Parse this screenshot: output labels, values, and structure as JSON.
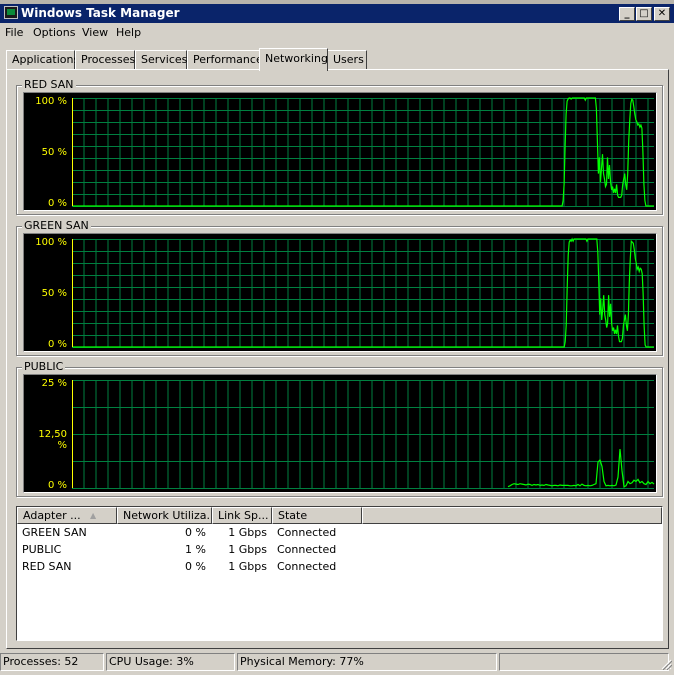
{
  "window": {
    "title": "Windows Task Manager",
    "icon": "task-manager-icon",
    "controls": {
      "minimize": "_",
      "maximize": "□",
      "close": "✕"
    }
  },
  "menu": [
    "File",
    "Options",
    "View",
    "Help"
  ],
  "tabs": [
    {
      "label": "Applications",
      "active": false
    },
    {
      "label": "Processes",
      "active": false
    },
    {
      "label": "Services",
      "active": false
    },
    {
      "label": "Performance",
      "active": false
    },
    {
      "label": "Networking",
      "active": true
    },
    {
      "label": "Users",
      "active": false
    }
  ],
  "colors": {
    "title_bar": "#0a246a",
    "graph_bg": "#000000",
    "grid": "#008040",
    "trace": "#00ff00",
    "axis_label": "#ffff00"
  },
  "chart_data": [
    {
      "type": "line",
      "title": "RED SAN",
      "yticks": [
        "100 %",
        "50 %",
        "0 %"
      ],
      "ylim": [
        0,
        100
      ],
      "grid": true,
      "samples_note": "history trace, oldest left, newest right; y in percent; null = no data",
      "values": [
        0,
        0,
        0,
        0,
        0,
        0,
        0,
        0,
        0,
        0,
        0,
        0,
        0,
        0,
        0,
        0,
        0,
        0,
        0,
        0,
        0,
        0,
        0,
        0,
        0,
        0,
        0,
        0,
        0,
        0,
        0,
        0,
        0,
        0,
        0,
        0,
        0,
        0,
        0,
        0,
        0,
        0,
        0,
        0,
        0,
        0,
        0,
        0,
        0,
        0,
        0,
        0,
        0,
        0,
        0,
        0,
        0,
        0,
        0,
        0,
        0,
        0,
        0,
        0,
        0,
        0,
        0,
        0,
        0,
        0,
        0,
        0,
        0,
        0,
        0,
        0,
        0,
        0,
        0,
        0,
        0,
        0,
        0,
        0,
        0,
        0,
        0,
        0,
        0,
        0,
        0,
        0,
        0,
        0,
        0,
        0,
        0,
        0,
        0,
        0,
        0,
        0,
        0,
        0,
        0,
        0,
        0,
        0,
        0,
        0,
        0,
        0,
        0,
        0,
        0,
        0,
        0,
        0,
        0,
        0,
        0,
        0,
        0,
        0,
        0,
        0,
        0,
        0,
        0,
        0,
        0,
        0,
        0,
        0,
        0,
        0,
        0,
        0,
        0,
        0,
        0,
        0,
        0,
        0,
        0,
        0,
        0,
        0,
        0,
        0,
        0,
        0,
        0,
        0,
        0,
        0,
        0,
        0,
        0,
        0,
        0,
        0,
        0,
        0,
        0,
        0,
        0,
        0,
        0,
        0,
        0,
        0,
        0,
        0,
        0,
        0,
        0,
        0,
        0,
        0,
        0,
        0,
        0,
        0,
        0,
        0,
        0,
        0,
        0,
        0,
        0,
        0,
        0,
        0,
        0,
        0,
        0,
        0,
        0,
        0,
        0,
        0,
        0,
        0,
        0,
        0,
        0,
        0,
        0,
        0,
        0,
        0,
        0,
        0,
        0,
        0,
        0,
        0,
        0,
        0,
        0,
        0,
        0,
        0,
        0,
        0,
        0,
        0,
        0,
        0,
        0,
        0,
        0,
        0,
        0,
        0,
        0,
        0,
        0,
        0,
        0,
        0,
        0,
        0,
        0,
        0,
        0,
        0,
        0,
        0,
        0,
        0,
        0,
        0,
        0,
        0,
        0,
        0,
        0,
        0,
        0,
        0,
        0,
        0,
        0,
        0,
        0,
        0,
        0,
        0,
        0,
        0,
        0,
        0,
        0,
        0,
        0,
        0,
        0,
        0,
        0,
        0,
        0,
        0,
        0,
        0,
        0,
        0,
        0,
        0,
        0,
        0,
        0,
        0,
        0,
        0,
        0,
        0,
        0,
        0,
        0,
        0,
        0,
        0,
        0,
        0,
        0,
        0,
        0,
        0,
        0,
        0,
        0,
        0,
        0,
        0,
        0,
        0,
        0,
        0,
        0,
        0,
        0,
        0,
        0,
        0,
        0,
        0,
        0,
        0,
        0,
        0,
        0,
        0,
        0,
        0,
        0,
        0,
        0,
        0,
        0,
        0,
        0,
        0,
        0,
        0,
        0,
        0,
        0,
        0,
        0,
        0,
        0,
        0,
        0,
        0,
        0,
        0,
        0,
        0,
        0,
        0,
        0,
        0,
        0,
        0,
        0,
        0,
        0,
        0,
        0,
        0,
        0,
        0,
        0,
        0,
        0,
        0,
        0,
        0,
        0,
        0,
        0,
        0,
        0,
        0,
        0,
        0,
        0,
        0,
        0,
        0,
        0,
        0,
        0,
        0,
        0,
        0,
        0,
        0,
        0,
        0,
        0,
        0,
        0,
        0,
        0,
        0,
        0,
        0,
        0,
        0,
        0,
        0,
        0,
        0,
        0,
        0,
        0,
        0,
        0,
        0,
        0,
        0,
        0,
        0,
        0,
        0,
        0,
        0,
        0,
        0,
        0,
        0,
        0,
        0,
        0,
        0,
        0,
        0,
        0,
        0,
        0,
        0,
        0,
        0,
        0,
        0,
        0,
        0,
        0,
        0,
        0,
        0,
        0,
        0,
        0,
        0,
        0,
        0,
        0,
        0,
        0,
        0,
        0,
        0,
        0,
        0,
        0,
        0,
        0,
        0,
        0,
        0,
        0,
        0,
        0,
        0,
        0,
        0,
        0,
        0,
        0,
        0,
        0,
        5,
        20,
        55,
        85,
        97,
        99,
        100,
        100,
        99,
        100,
        100,
        100,
        100,
        100,
        100,
        100,
        100,
        100,
        100,
        100,
        100,
        100,
        98,
        100,
        100,
        100,
        100,
        100,
        100,
        100,
        100,
        100,
        100,
        90,
        60,
        30,
        45,
        22,
        35,
        48,
        30,
        25,
        18,
        20,
        45,
        25,
        38,
        22,
        15,
        18,
        12,
        16,
        12,
        20,
        10,
        8,
        8,
        8,
        10,
        20,
        25,
        30,
        20,
        15,
        30,
        60,
        80,
        95,
        99,
        98,
        92,
        85,
        80,
        78,
        75,
        76,
        73,
        75,
        72,
        50,
        20,
        5,
        0,
        0,
        0,
        0,
        0,
        0,
        0,
        0,
        0
      ]
    },
    {
      "type": "line",
      "title": "GREEN SAN",
      "yticks": [
        "100 %",
        "50 %",
        "0 %"
      ],
      "ylim": [
        0,
        100
      ],
      "grid": true,
      "values": [
        0,
        0,
        0,
        0,
        0,
        0,
        0,
        0,
        0,
        0,
        0,
        0,
        0,
        0,
        0,
        0,
        0,
        0,
        0,
        0,
        0,
        0,
        0,
        0,
        0,
        0,
        0,
        0,
        0,
        0,
        0,
        0,
        0,
        0,
        0,
        0,
        0,
        0,
        0,
        0,
        0,
        0,
        0,
        0,
        0,
        0,
        0,
        0,
        0,
        0,
        0,
        0,
        0,
        0,
        0,
        0,
        0,
        0,
        0,
        0,
        0,
        0,
        0,
        0,
        0,
        0,
        0,
        0,
        0,
        0,
        0,
        0,
        0,
        0,
        0,
        0,
        0,
        0,
        0,
        0,
        0,
        0,
        0,
        0,
        0,
        0,
        0,
        0,
        0,
        0,
        0,
        0,
        0,
        0,
        0,
        0,
        0,
        0,
        0,
        0,
        0,
        0,
        0,
        0,
        0,
        0,
        0,
        0,
        0,
        0,
        0,
        0,
        0,
        0,
        0,
        0,
        0,
        0,
        0,
        0,
        0,
        0,
        0,
        0,
        0,
        0,
        0,
        0,
        0,
        0,
        0,
        0,
        0,
        0,
        0,
        0,
        0,
        0,
        0,
        0,
        0,
        0,
        0,
        0,
        0,
        0,
        0,
        0,
        0,
        0,
        0,
        0,
        0,
        0,
        0,
        0,
        0,
        0,
        0,
        0,
        0,
        0,
        0,
        0,
        0,
        0,
        0,
        0,
        0,
        0,
        0,
        0,
        0,
        0,
        0,
        0,
        0,
        0,
        0,
        0,
        0,
        0,
        0,
        0,
        0,
        0,
        0,
        0,
        0,
        0,
        0,
        0,
        0,
        0,
        0,
        0,
        0,
        0,
        0,
        0,
        0,
        0,
        0,
        0,
        0,
        0,
        0,
        0,
        0,
        0,
        0,
        0,
        0,
        0,
        0,
        0,
        0,
        0,
        0,
        0,
        0,
        0,
        0,
        0,
        0,
        0,
        0,
        0,
        0,
        0,
        0,
        0,
        0,
        0,
        0,
        0,
        0,
        0,
        0,
        0,
        0,
        0,
        0,
        0,
        0,
        0,
        0,
        0,
        0,
        0,
        0,
        0,
        0,
        0,
        0,
        0,
        0,
        0,
        0,
        0,
        0,
        0,
        0,
        0,
        0,
        0,
        0,
        0,
        0,
        0,
        0,
        0,
        0,
        0,
        0,
        0,
        0,
        0,
        0,
        0,
        0,
        0,
        0,
        0,
        0,
        0,
        0,
        0,
        0,
        0,
        0,
        0,
        0,
        0,
        0,
        0,
        0,
        0,
        0,
        0,
        0,
        0,
        0,
        0,
        0,
        0,
        0,
        0,
        0,
        0,
        0,
        0,
        0,
        0,
        0,
        0,
        0,
        0,
        0,
        0,
        0,
        0,
        0,
        0,
        0,
        0,
        0,
        0,
        0,
        0,
        0,
        0,
        0,
        0,
        0,
        0,
        0,
        0,
        0,
        0,
        0,
        0,
        0,
        0,
        0,
        0,
        0,
        0,
        0,
        0,
        0,
        0,
        0,
        0,
        0,
        0,
        0,
        0,
        0,
        0,
        0,
        0,
        0,
        0,
        0,
        0,
        0,
        0,
        0,
        0,
        0,
        0,
        0,
        0,
        0,
        0,
        0,
        0,
        0,
        0,
        0,
        0,
        0,
        0,
        0,
        0,
        0,
        0,
        0,
        0,
        0,
        0,
        0,
        0,
        0,
        0,
        0,
        0,
        0,
        0,
        0,
        0,
        0,
        0,
        0,
        0,
        0,
        0,
        0,
        0,
        0,
        0,
        0,
        0,
        0,
        0,
        0,
        0,
        0,
        0,
        0,
        0,
        0,
        0,
        0,
        0,
        0,
        0,
        0,
        0,
        0,
        0,
        0,
        0,
        0,
        0,
        0,
        0,
        0,
        0,
        0,
        0,
        0,
        0,
        0,
        0,
        0,
        0,
        0,
        0,
        0,
        0,
        0,
        0,
        0,
        0,
        0,
        0,
        0,
        0,
        0,
        0,
        0,
        0,
        0,
        0,
        0,
        0,
        0,
        0,
        0,
        0,
        0,
        0,
        0,
        0,
        0,
        0,
        0,
        0,
        0,
        0,
        0,
        0,
        0,
        0,
        0,
        0,
        0,
        0,
        0,
        0,
        0,
        0,
        0,
        0,
        0,
        0,
        0,
        5,
        20,
        55,
        85,
        97,
        99,
        98,
        100,
        98,
        100,
        100,
        100,
        100,
        100,
        100,
        100,
        100,
        100,
        100,
        100,
        100,
        100,
        98,
        100,
        100,
        100,
        100,
        100,
        100,
        100,
        100,
        100,
        100,
        88,
        60,
        30,
        45,
        25,
        35,
        48,
        30,
        25,
        18,
        22,
        48,
        28,
        40,
        22,
        15,
        18,
        12,
        16,
        12,
        20,
        10,
        5,
        5,
        5,
        8,
        20,
        25,
        30,
        20,
        15,
        30,
        60,
        82,
        98,
        97,
        96,
        90,
        82,
        78,
        72,
        74,
        70,
        73,
        72,
        68,
        50,
        20,
        2,
        0,
        0,
        0,
        0,
        0,
        0,
        0,
        0,
        0
      ]
    },
    {
      "type": "line",
      "title": "PUBLIC",
      "yticks": [
        "25 %",
        "12,50 %",
        "0 %"
      ],
      "ylim": [
        0,
        25
      ],
      "grid": true,
      "values": [
        0.3,
        0.5,
        0.8,
        1.0,
        0.9,
        0.8,
        1.0,
        0.9,
        0.8,
        0.7,
        0.9,
        0.8,
        0.6,
        0.8,
        0.7,
        0.8,
        0.6,
        0.7,
        0.6,
        0.8,
        0.7,
        0.6,
        0.5,
        0.6,
        0.6,
        0.5,
        0.7,
        0.6,
        0.6,
        0.6,
        0.6,
        0.5,
        0.5,
        0.6,
        0.5,
        0.8,
        0.5,
        0.9,
        0.6,
        0.5,
        0.6,
        0.5,
        0.6,
        0.8,
        1.0,
        6.0,
        6.5,
        5.0,
        1.5,
        0.5,
        0.6,
        0.5,
        0.6,
        0.5,
        0.7,
        2.5,
        9.0,
        4.0,
        0.3,
        0.5,
        1.5,
        1.0,
        1.2,
        1.8,
        1.5,
        2.0,
        1.2,
        1.5,
        1.0,
        0.8,
        1.5,
        1.0,
        1.3,
        0.9
      ]
    }
  ],
  "adapters": {
    "columns": [
      "Adapter ...",
      "Network Utiliza...",
      "Link Sp...",
      "State"
    ],
    "sort_indicator": "sort-ascending-icon",
    "rows": [
      {
        "adapter": "GREEN SAN",
        "utilization": "0 %",
        "link_speed": "1 Gbps",
        "state": "Connected"
      },
      {
        "adapter": "PUBLIC",
        "utilization": "1 %",
        "link_speed": "1 Gbps",
        "state": "Connected"
      },
      {
        "adapter": "RED SAN",
        "utilization": "0 %",
        "link_speed": "1 Gbps",
        "state": "Connected"
      }
    ]
  },
  "status": {
    "processes": "Processes: 52",
    "cpu": "CPU Usage: 3%",
    "memory": "Physical Memory: 77%"
  }
}
